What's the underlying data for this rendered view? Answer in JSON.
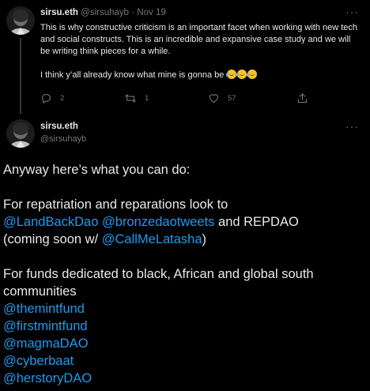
{
  "tweet1": {
    "display_name": "sirsu.eth",
    "handle": "@sirsuhayb",
    "separator": "·",
    "date": "Nov 19",
    "paragraph1": "This is why constructive criticism is an important facet when working with new tech and social constructs. This is an incredible and expansive case study and we will be writing think pieces for a while.",
    "paragraph2": "I think y’all already know what mine is gonna be",
    "emojis": [
      "rolling-on-floor-laughing-emoji",
      "rolling-on-floor-laughing-emoji",
      "rolling-on-floor-laughing-emoji"
    ],
    "reply_count": "2",
    "retweet_count": "1",
    "like_count": "57",
    "icons": [
      "reply-icon",
      "retweet-icon",
      "like-icon",
      "share-icon",
      "more-icon"
    ]
  },
  "tweet2": {
    "display_name": "sirsu.eth",
    "handle": "@sirsuhayb",
    "intro": "Anyway here’s what you can do:",
    "repatriation_line1": "For repatriation and reparations look to",
    "mention_landback": "@LandBackDao",
    "mention_bronzedao": "@bronzedaotweets",
    "and_repdao": " and REPDAO",
    "coming_soon": "(coming soon w/ ",
    "mention_callmelatasha": "@CallMeLatasha",
    "close_paren": ")",
    "funds_line1": "For funds dedicated to black, African and global south",
    "funds_line2": "communities",
    "fund_mentions": [
      "@themintfund",
      "@firstmintfund",
      "@magmaDAO",
      "@cyberbaat",
      "@herstoryDAO"
    ]
  },
  "colors": {
    "background": "#000000",
    "text": "#e7e9ea",
    "secondary": "#71767b",
    "link": "#1d9bf0",
    "divider": "#333639"
  }
}
